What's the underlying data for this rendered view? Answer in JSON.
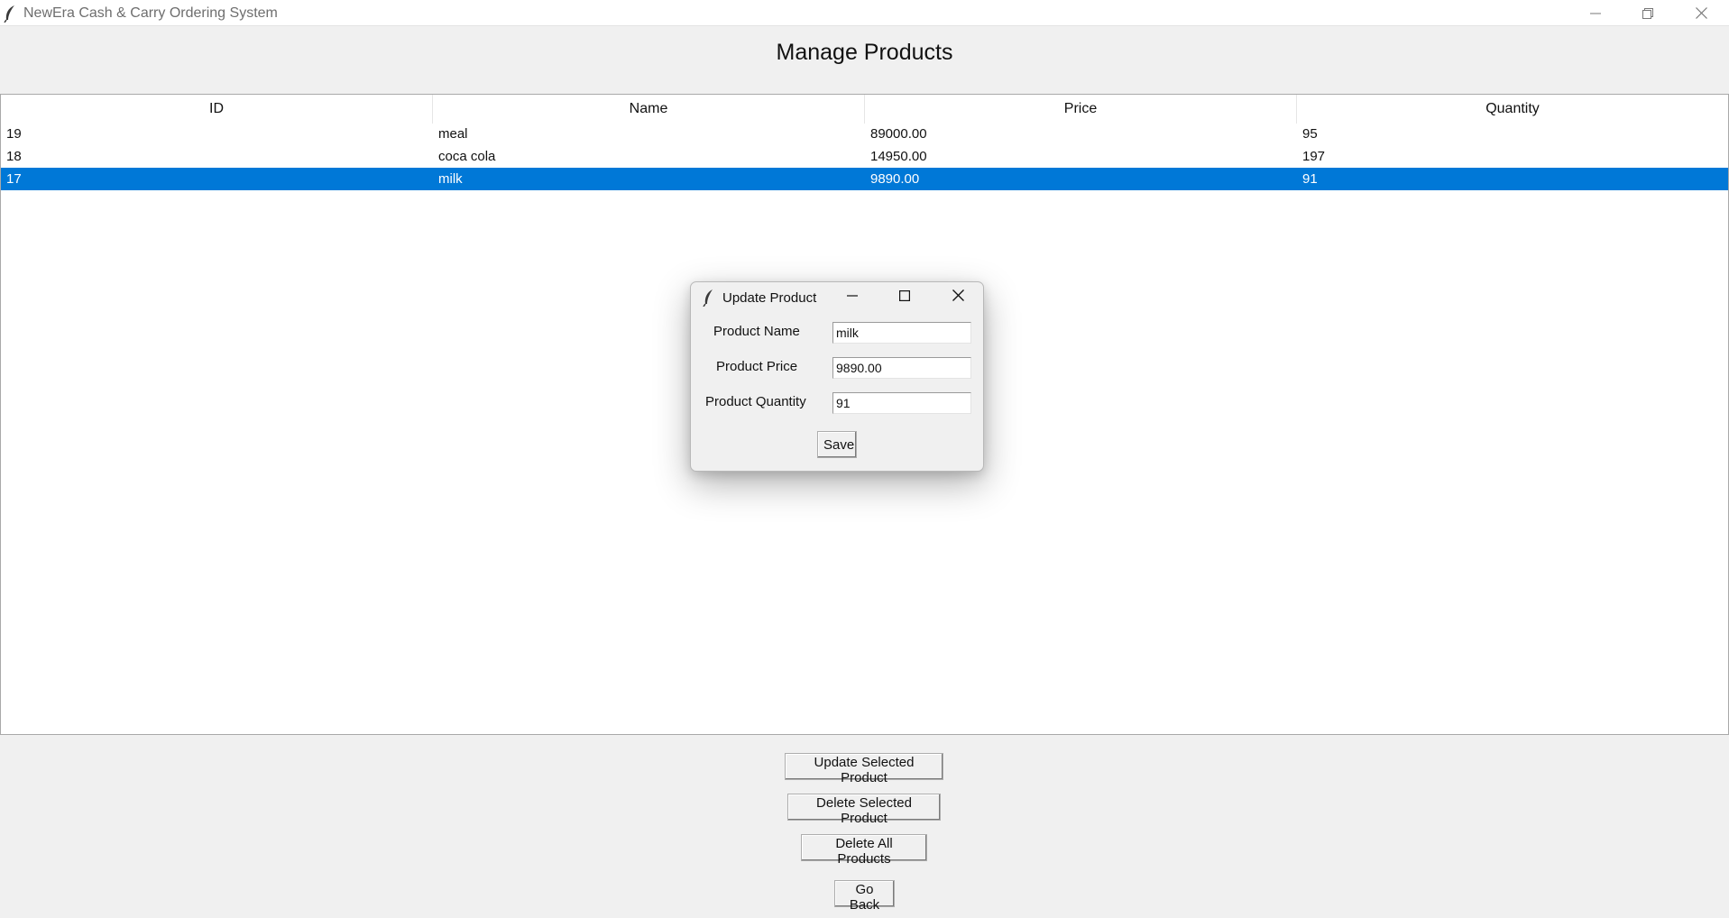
{
  "window": {
    "title": "NewEra Cash & Carry Ordering System"
  },
  "page": {
    "heading": "Manage Products"
  },
  "table": {
    "columns": [
      "ID",
      "Name",
      "Price",
      "Quantity"
    ],
    "rows": [
      {
        "id": "19",
        "name": "meal",
        "price": "89000.00",
        "quantity": "95",
        "selected": false
      },
      {
        "id": "18",
        "name": "coca cola",
        "price": "14950.00",
        "quantity": "197",
        "selected": false
      },
      {
        "id": "17",
        "name": "milk",
        "price": "9890.00",
        "quantity": "91",
        "selected": true
      }
    ],
    "selection_color": "#0078d7"
  },
  "actions": {
    "update_label": "Update Selected Product",
    "delete_label": "Delete Selected Product",
    "delete_all_label": "Delete All Products",
    "back_label": "Go Back"
  },
  "dialog": {
    "title": "Update Product",
    "name_label": "Product Name",
    "price_label": "Product Price",
    "quantity_label": "Product Quantity",
    "name_value": "milk",
    "price_value": "9890.00",
    "quantity_value": "91",
    "save_label": "Save"
  },
  "icons": {
    "app": "feather-icon",
    "minimize": "minimize-icon",
    "maximize": "maximize-icon",
    "restore": "restore-icon",
    "close": "close-icon"
  }
}
